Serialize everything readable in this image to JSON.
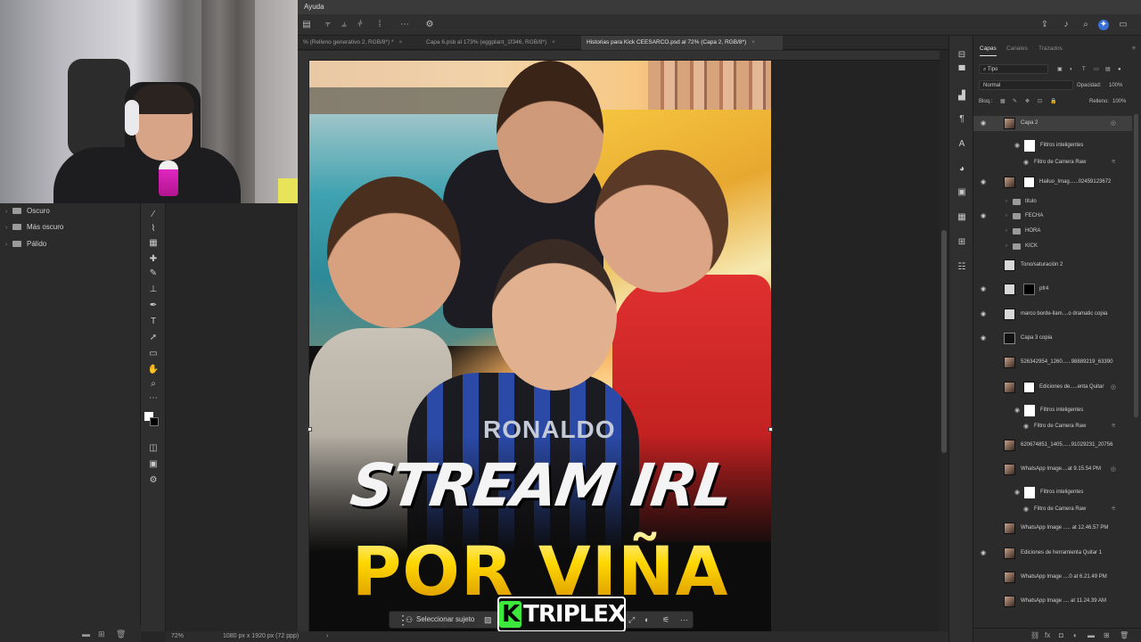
{
  "menubar": {
    "help": "Ayuda"
  },
  "tabs": [
    {
      "label": "% (Relleno generativo 2, RGB/8*) *",
      "close": "×"
    },
    {
      "label": "Capa 6.psb al 173% (eggplant_1f346, RGB/8*)",
      "close": "×"
    },
    {
      "label": "Historias para Kick CEESARCO.psd al 72% (Capa 2, RGB/8*)",
      "close": "×"
    }
  ],
  "presets": {
    "items": [
      {
        "label": "Oscuro"
      },
      {
        "label": "Más oscuro"
      },
      {
        "label": "Pálido"
      }
    ]
  },
  "canvas": {
    "jersey_text": "RONALDO",
    "title_line1": "STREAM IRL",
    "title_line2": "POR VIÑA"
  },
  "taskbar": {
    "select_subject": "Seleccionar sujeto"
  },
  "watermark": {
    "k": "K",
    "rest": "TRIPLEX"
  },
  "statusbar": {
    "zoom": "72%",
    "doc_size": "1080 px x 1920 px (72 ppp)"
  },
  "layers_panel": {
    "tabs": {
      "layers": "Capas",
      "channels": "Canales",
      "paths": "Trazados"
    },
    "filter_kind": "Tipo",
    "blend_mode": "Normal",
    "opacity_label": "Opacidad:",
    "opacity_value": "100%",
    "lock_label": "Bloq.:",
    "fill_label": "Relleno:",
    "fill_value": "100%",
    "layers": [
      {
        "name": "Capa 2"
      },
      {
        "name": "Filtros inteligentes"
      },
      {
        "name": "Filtro de Camera Raw"
      },
      {
        "name": "Hailuo_Imag......02459123672"
      },
      {
        "name": "titulo"
      },
      {
        "name": "FECHA"
      },
      {
        "name": "HORA"
      },
      {
        "name": "KICK"
      },
      {
        "name": "Tono/saturación 2"
      },
      {
        "name": "pfr4"
      },
      {
        "name": "marco borde-llam....o dramatic copia"
      },
      {
        "name": "Capa 3 copia"
      },
      {
        "name": "526342954_1260......98889219_63390"
      },
      {
        "name": "Ediciones de.....enta Quitar"
      },
      {
        "name": "Filtros inteligentes"
      },
      {
        "name": "Filtro de Camera Raw"
      },
      {
        "name": "620674851_1405......91029231_20756"
      },
      {
        "name": "WhatsApp Image....at 9.15.54 PM"
      },
      {
        "name": "Filtros inteligentes"
      },
      {
        "name": "Filtro de Camera Raw"
      },
      {
        "name": "WhatsApp Image ..... at 12.46.57 PM"
      },
      {
        "name": "Ediciones de herramienta Quitar 1"
      },
      {
        "name": "WhatsApp Image ....0 at 6.21.49 PM"
      },
      {
        "name": "WhatsApp Image .... at 11.24.39 AM"
      }
    ]
  }
}
